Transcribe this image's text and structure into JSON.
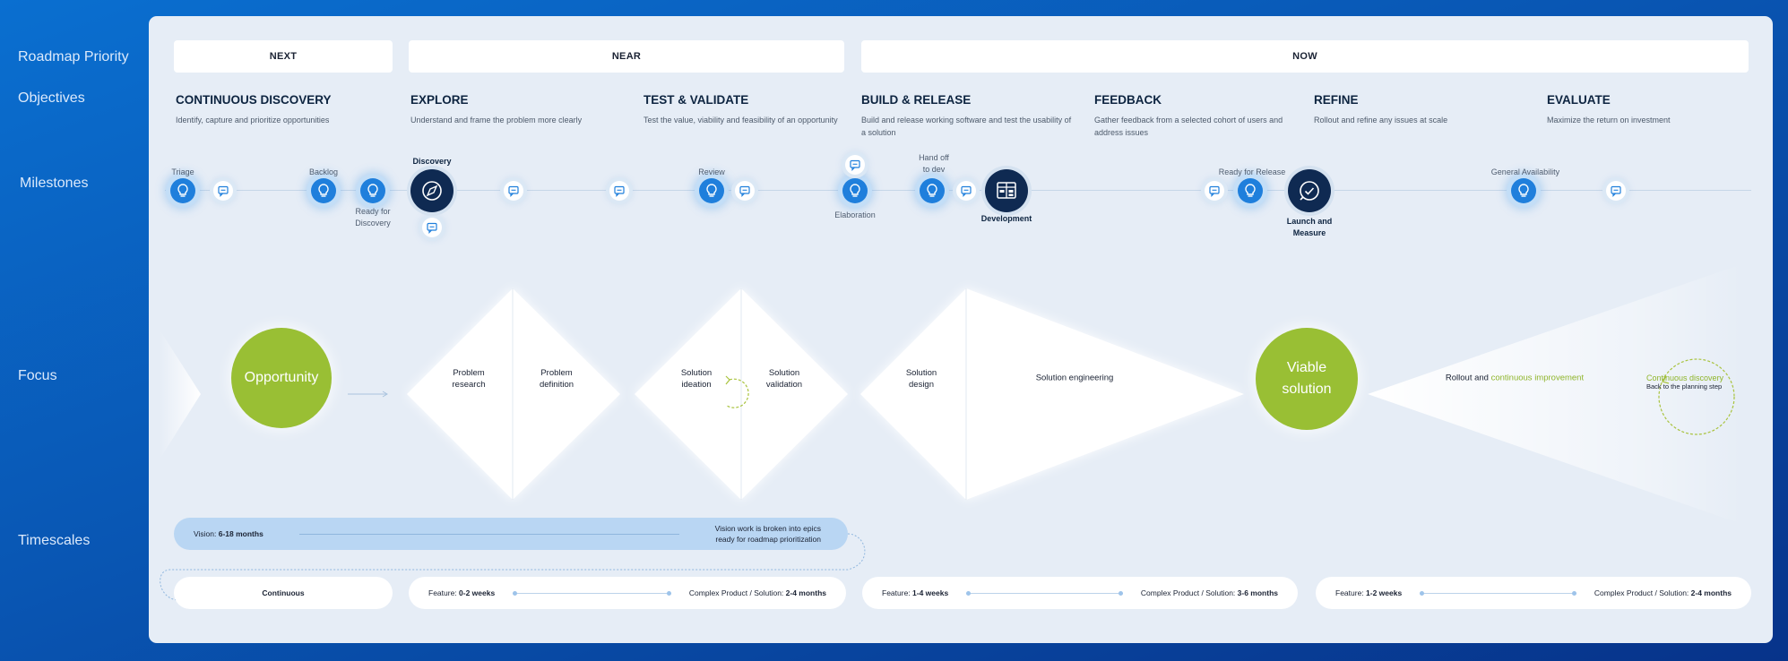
{
  "row_labels": {
    "priority": "Roadmap Priority",
    "objectives": "Objectives",
    "milestones": "Milestones",
    "focus": "Focus",
    "timescales": "Timescales"
  },
  "priorities": {
    "next": "NEXT",
    "near": "NEAR",
    "now": "NOW"
  },
  "objectives": [
    {
      "title": "CONTINUOUS DISCOVERY",
      "desc": "Identify, capture and prioritize opportunities"
    },
    {
      "title": "EXPLORE",
      "desc": "Understand and frame the problem more clearly"
    },
    {
      "title": "TEST & VALIDATE",
      "desc": "Test the value, viability and feasibility of an opportunity"
    },
    {
      "title": "BUILD & RELEASE",
      "desc": "Build and release working software and test the usability of a solution"
    },
    {
      "title": "FEEDBACK",
      "desc": "Gather feedback from a selected cohort of users and address issues"
    },
    {
      "title": "REFINE",
      "desc": "Rollout and refine any issues at scale"
    },
    {
      "title": "EVALUATE",
      "desc": "Maximize the return on investment"
    }
  ],
  "milestones": {
    "triage": "Triage",
    "backlog": "Backlog",
    "ready_discovery_1": "Ready for",
    "ready_discovery_2": "Discovery",
    "discovery": "Discovery",
    "review": "Review",
    "elaboration": "Elaboration",
    "handoff_1": "Hand off",
    "handoff_2": "to dev",
    "development": "Development",
    "ready_release": "Ready for Release",
    "launch_1": "Launch and",
    "launch_2": "Measure",
    "ga": "General Availability"
  },
  "focus": {
    "opportunity": "Opportunity",
    "problem_research_1": "Problem",
    "problem_research_2": "research",
    "problem_definition_1": "Problem",
    "problem_definition_2": "definition",
    "solution_ideation_1": "Solution",
    "solution_ideation_2": "ideation",
    "solution_validation_1": "Solution",
    "solution_validation_2": "validation",
    "solution_design_1": "Solution",
    "solution_design_2": "design",
    "solution_engineering": "Solution engineering",
    "viable_1": "Viable",
    "viable_2": "solution",
    "rollout_a": "Rollout and ",
    "rollout_b": "continuous improvement",
    "cont_discovery": "Continuous discovery",
    "back_planning": "Back to the planning step"
  },
  "timescales": {
    "vision_label": "Vision: ",
    "vision_value": "6-18 months",
    "vision_note_1": "Vision work is broken into epics",
    "vision_note_2": "ready for roadmap prioritization",
    "continuous": "Continuous",
    "near_feature_label": "Feature: ",
    "near_feature_value": "0-2 weeks",
    "near_complex_label": "Complex Product / Solution: ",
    "near_complex_value": "2-4 months",
    "now1_feature_label": "Feature: ",
    "now1_feature_value": "1-4 weeks",
    "now1_complex_label": "Complex Product / Solution: ",
    "now1_complex_value": "3-6 months",
    "now2_feature_label": "Feature: ",
    "now2_feature_value": "1-2 weeks",
    "now2_complex_label": "Complex Product / Solution: ",
    "now2_complex_value": "2-4 months"
  },
  "colors": {
    "accent_green": "#99bf34",
    "bulb_blue": "#1f7fdc",
    "dark_navy": "#0f2a52"
  },
  "icons": [
    "lightbulb-icon",
    "chat-icon",
    "compass-icon",
    "kanban-icon",
    "check-badge-icon"
  ]
}
